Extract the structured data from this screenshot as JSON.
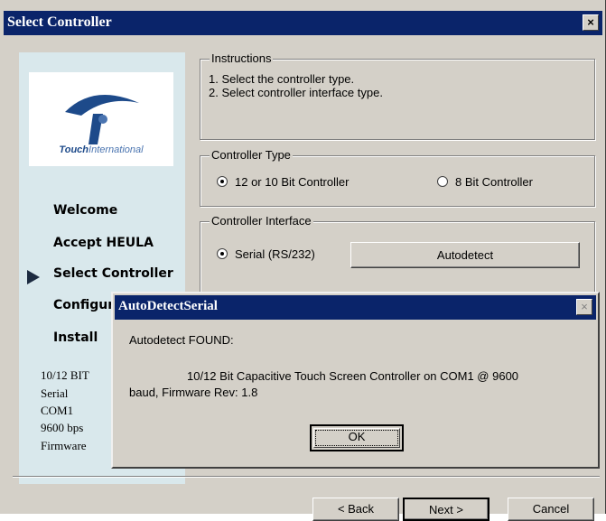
{
  "window": {
    "title": "Select Controller",
    "close_glyph": "×"
  },
  "sidebar": {
    "logo": {
      "brand_bold": "Touch",
      "brand_rest": "International"
    },
    "steps": [
      {
        "label": "Welcome"
      },
      {
        "label": "Accept HEULA"
      },
      {
        "label": "Select Controller",
        "current": true
      },
      {
        "label": "Configur"
      },
      {
        "label": "Install"
      }
    ],
    "summary": [
      "10/12 BIT",
      "Serial",
      "COM1",
      "9600 bps",
      "Firmware"
    ]
  },
  "instructions": {
    "legend": "Instructions",
    "lines": [
      "1. Select the controller type.",
      "2. Select controller interface type."
    ]
  },
  "controller_type": {
    "legend": "Controller Type",
    "option1": "12 or 10 Bit Controller",
    "option2": "8 Bit Controller",
    "selected": "option1"
  },
  "controller_interface": {
    "legend": "Controller Interface",
    "option1": "Serial (RS/232)",
    "autodetect_label": "Autodetect"
  },
  "footer": {
    "back_label": "< Back",
    "next_label": "Next >",
    "cancel_label": "Cancel"
  },
  "dialog": {
    "title": "AutoDetectSerial",
    "close_glyph": "×",
    "heading": "Autodetect FOUND:",
    "message_line1": "10/12 Bit Capacitive Touch Screen Controller on COM1 @ 9600",
    "message_line2": "baud, Firmware Rev: 1.8",
    "ok_label": "OK"
  },
  "colors": {
    "titlebar": "#0a246a",
    "face": "#d4d0c8",
    "sidebar": "#d9e8ec",
    "logo_blue": "#1d4a8a"
  }
}
